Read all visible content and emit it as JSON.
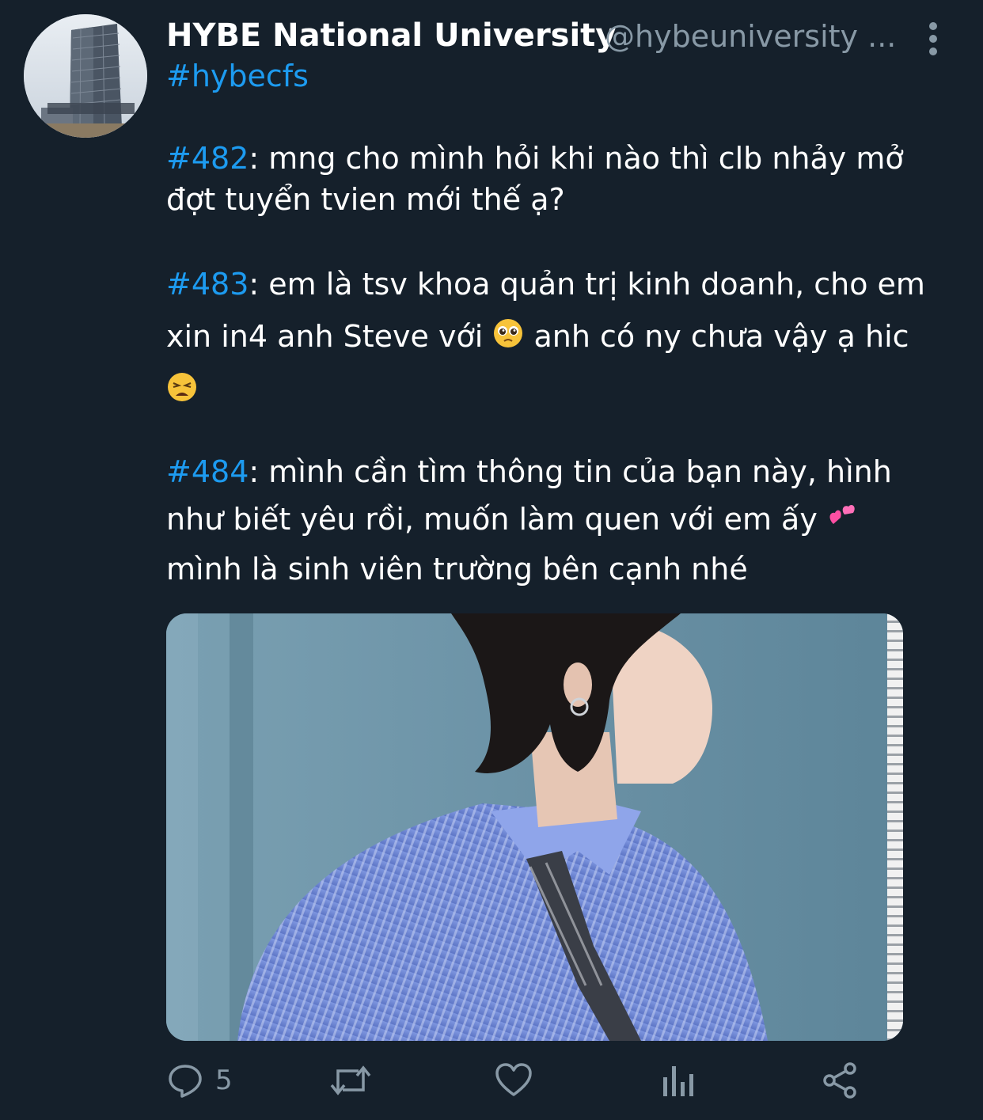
{
  "tweet": {
    "display_name": "HYBE National University",
    "handle": "@hybeuniversity ...",
    "hashtag": "#hybecfs",
    "posts": [
      {
        "tag": "#482",
        "text": ": mng cho mình hỏi khi nào thì clb nhảy mở đợt tuyển tvien mới thế ạ?"
      },
      {
        "tag": "#483",
        "text_a": ": em là tsv khoa quản trị kinh doanh, cho em xin in4 anh Steve với",
        "text_b": " anh có ny chưa vậy ạ hic"
      },
      {
        "tag": "#484",
        "text_a": ": mình cần tìm thông tin của bạn này, hình như biết yêu rồi, muốn làm quen với em ấy",
        "text_b": "mình là sinh viên trường bên cạnh nhé"
      }
    ],
    "actions": {
      "reply_count": "5"
    }
  },
  "icons": [
    "more-vertical-icon",
    "pleading-face-icon",
    "weary-face-icon",
    "two-hearts-icon",
    "reply-icon",
    "retweet-icon",
    "like-icon",
    "analytics-icon",
    "share-icon"
  ],
  "colors": {
    "background": "#15202b",
    "link": "#1d9bf0",
    "muted": "#8899a6",
    "text": "#ffffff"
  }
}
